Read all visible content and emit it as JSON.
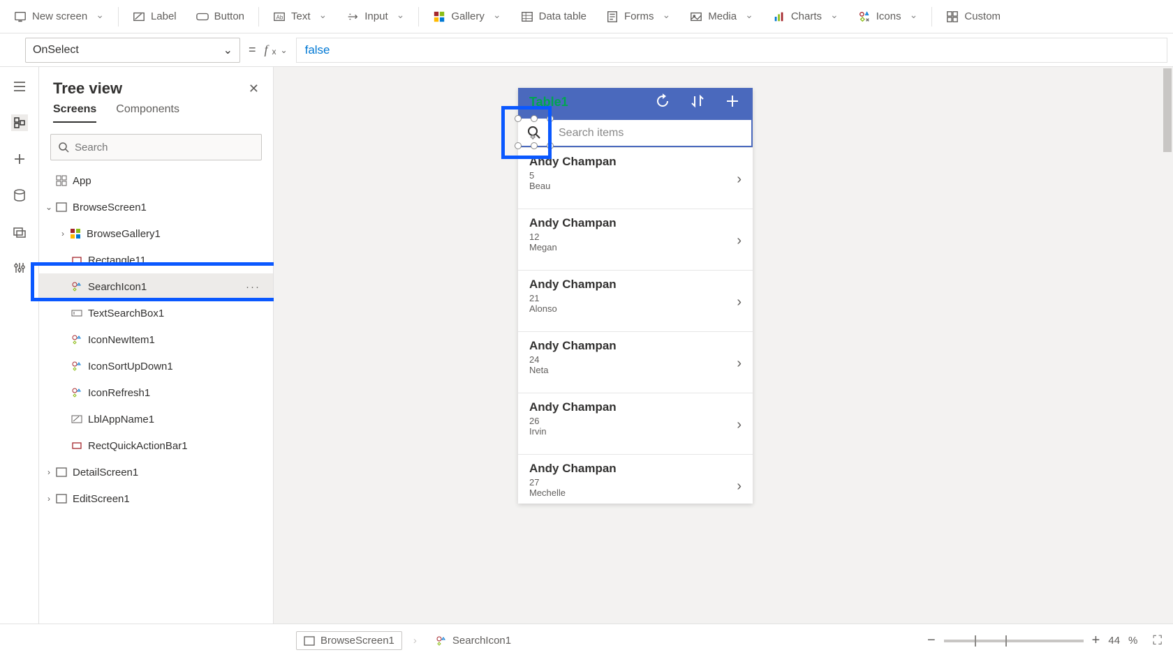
{
  "toolbar": {
    "new_screen": "New screen",
    "label": "Label",
    "button": "Button",
    "text": "Text",
    "input": "Input",
    "gallery": "Gallery",
    "data_table": "Data table",
    "forms": "Forms",
    "media": "Media",
    "charts": "Charts",
    "icons": "Icons",
    "custom": "Custom"
  },
  "propbar": {
    "property": "OnSelect",
    "formula": "false"
  },
  "panel": {
    "title": "Tree view",
    "tab_screens": "Screens",
    "tab_components": "Components",
    "search_placeholder": "Search"
  },
  "tree": {
    "app": "App",
    "browse_screen": "BrowseScreen1",
    "browse_gallery": "BrowseGallery1",
    "rectangle": "Rectangle11",
    "search_icon": "SearchIcon1",
    "text_search": "TextSearchBox1",
    "icon_new": "IconNewItem1",
    "icon_sort": "IconSortUpDown1",
    "icon_refresh": "IconRefresh1",
    "lbl_app": "LblAppName1",
    "rect_quick": "RectQuickActionBar1",
    "detail_screen": "DetailScreen1",
    "edit_screen": "EditScreen1"
  },
  "app": {
    "title": "Table1",
    "search_placeholder": "Search items",
    "gallery": [
      {
        "title": "Andy Champan",
        "line1": "5",
        "line2": "Beau"
      },
      {
        "title": "Andy Champan",
        "line1": "12",
        "line2": "Megan"
      },
      {
        "title": "Andy Champan",
        "line1": "21",
        "line2": "Alonso"
      },
      {
        "title": "Andy Champan",
        "line1": "24",
        "line2": "Neta"
      },
      {
        "title": "Andy Champan",
        "line1": "26",
        "line2": "Irvin"
      },
      {
        "title": "Andy Champan",
        "line1": "27",
        "line2": "Mechelle"
      }
    ]
  },
  "status": {
    "bread1": "BrowseScreen1",
    "bread2": "SearchIcon1",
    "zoom": "44",
    "zoom_suffix": "%"
  }
}
